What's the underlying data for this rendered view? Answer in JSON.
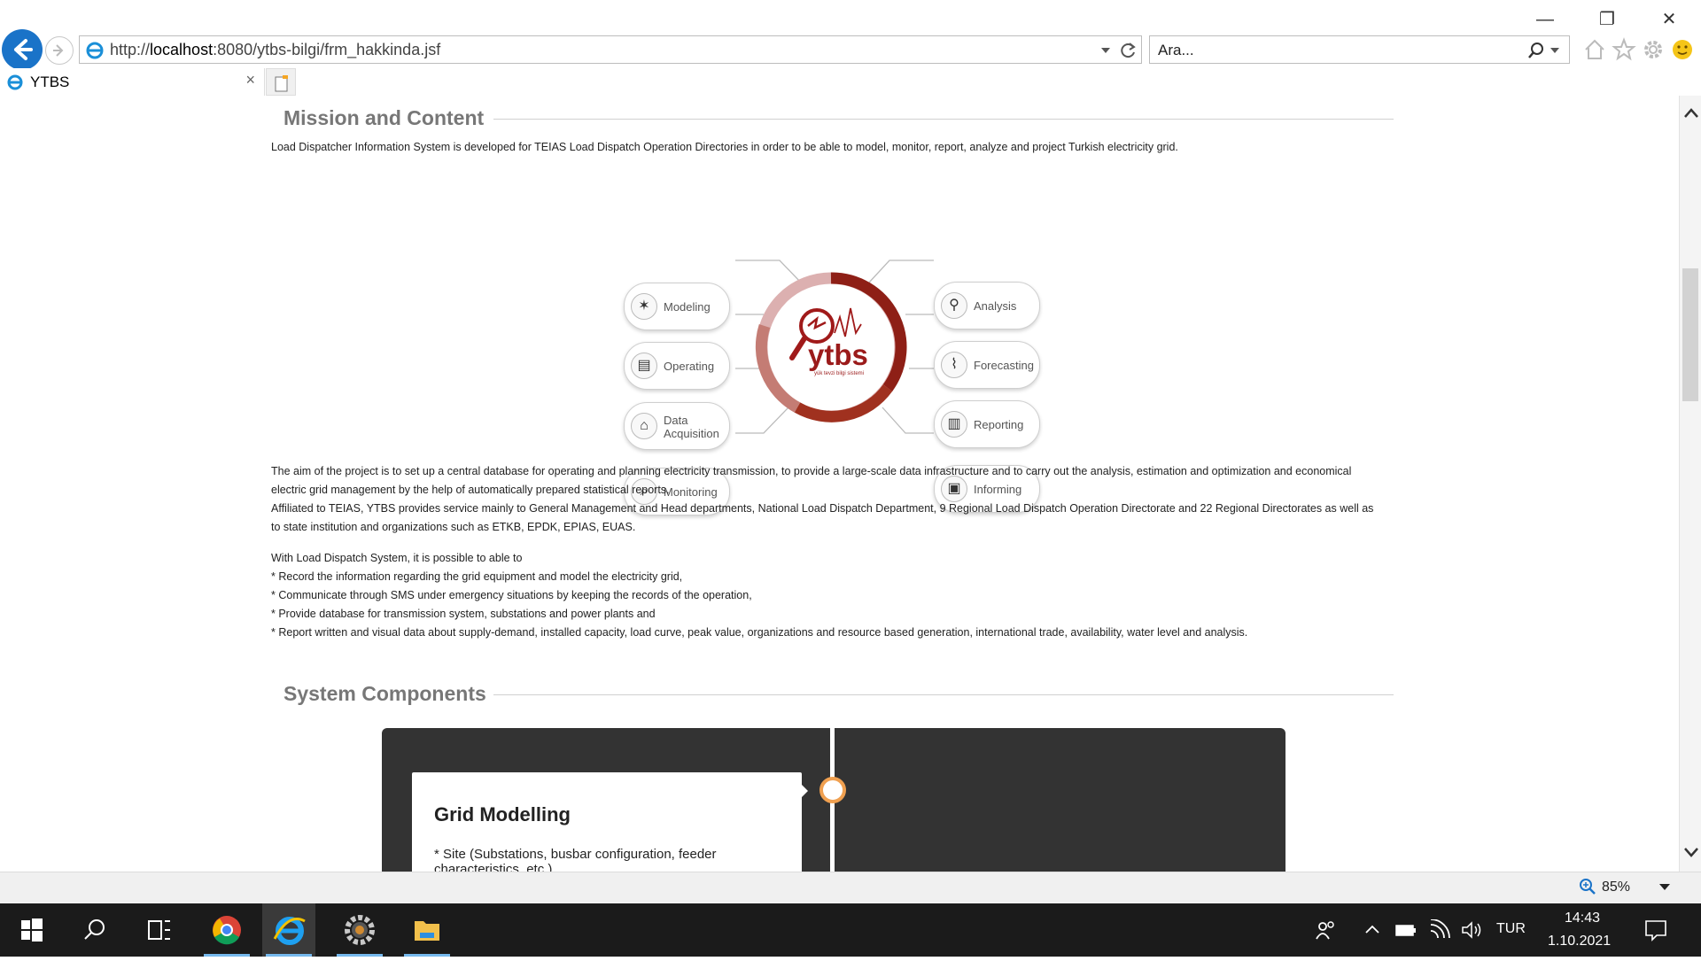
{
  "browser": {
    "url_prefix": "http://",
    "url_host": "localhost",
    "url_rest": ":8080/ytbs-bilgi/frm_hakkinda.jsf",
    "search_placeholder": "Ara...",
    "tab_title": "YTBS",
    "tab_close": "×",
    "zoom": "85%"
  },
  "window_controls": {
    "minimize": "—",
    "restore": "❐",
    "close": "✕"
  },
  "page": {
    "mission_title": "Mission and Content",
    "mission_intro": "Load Dispatcher Information System is developed for TEIAS Load Dispatch Operation Directories in order to be able to model, monitor, report, analyze and project Turkish electricity grid.",
    "diagram": {
      "logo_text": "ytbs",
      "logo_sub": "yük tevzi bilgi sistemi",
      "left": [
        {
          "label": "Modeling",
          "icon": "network-icon",
          "glyph": "✶"
        },
        {
          "label": "Operating",
          "icon": "panel-icon",
          "glyph": "▤"
        },
        {
          "label": "Data\nAcquisition",
          "icon": "antenna-icon",
          "glyph": "⌂"
        },
        {
          "label": "Monitoring",
          "icon": "monitor-search-icon",
          "glyph": "⌕"
        }
      ],
      "right": [
        {
          "label": "Analysis",
          "icon": "magnifier-icon",
          "glyph": "⚲"
        },
        {
          "label": "Forecasting",
          "icon": "trend-chart-icon",
          "glyph": "⌇"
        },
        {
          "label": "Reporting",
          "icon": "report-icon",
          "glyph": "▥"
        },
        {
          "label": "Informing",
          "icon": "info-board-icon",
          "glyph": "▣"
        }
      ]
    },
    "aim_para_1": "The aim of the project is to set up a central database for operating and planning electricity transmission, to provide a large-scale data infrastructure and to carry out the analysis, estimation and optimization and economical electric grid management by the help of automatically prepared statistical reports.",
    "aim_para_2": "Affiliated to TEIAS, YTBS provides service mainly to General Management and Head departments, National Load Dispatch Department, 9 Regional Load Dispatch Operation Directorate and 22 Regional Directorates as well as to state institution and organizations such as ETKB, EPDK, EPIAS, EUAS.",
    "possible_intro": "With Load Dispatch System, it is possible to able to",
    "possible_items": [
      "* Record the information regarding the grid equipment and model the electricity grid,",
      "* Communicate through SMS under emergency situations by keeping the records of the operation,",
      "* Provide database for transmission system, substations and power plants and",
      "* Report written and visual data about supply-demand, installed capacity, load curve, peak value, organizations and resource based generation, international trade, availability, water level and analysis."
    ],
    "components_title": "System Components",
    "timeline_card_title": "Grid Modelling",
    "timeline_card_text": "* Site (Substations, busbar configuration, feeder characteristics, etc.)"
  },
  "taskbar": {
    "language": "TUR",
    "time": "14:43",
    "date": "1.10.2021"
  },
  "colors": {
    "accent_blue": "#1a73c8",
    "ytbs_red": "#9b1b1b",
    "section_title": "#777777"
  }
}
